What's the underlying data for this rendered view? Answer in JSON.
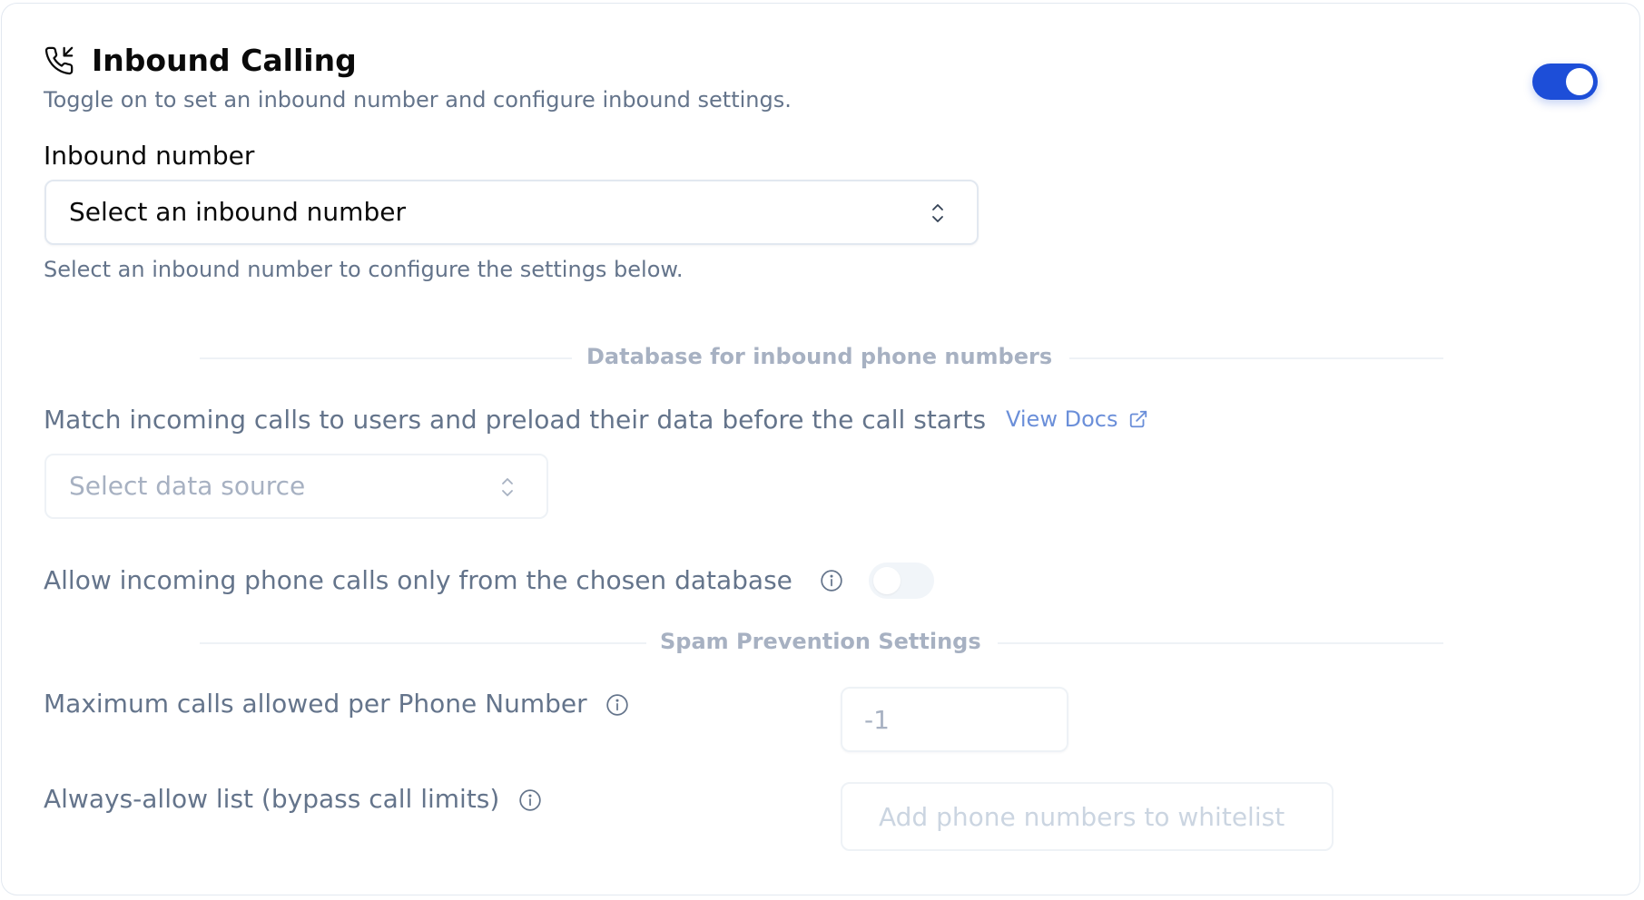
{
  "header": {
    "title": "Inbound Calling",
    "subtitle": "Toggle on to set an inbound number and configure inbound settings.",
    "icon": "phone-incoming-icon",
    "toggle_enabled": true,
    "accent_color": "#1d4ed8"
  },
  "inbound_number": {
    "label": "Inbound number",
    "placeholder": "Select an inbound number",
    "helper": "Select an inbound number to configure the settings below."
  },
  "database_section": {
    "heading": "Database for inbound phone numbers",
    "description": "Match incoming calls to users and preload their data before the call starts",
    "docs_link": "View Docs",
    "data_source_placeholder": "Select data source",
    "allow_only_label": "Allow incoming phone calls only from the chosen database",
    "allow_only_enabled": false
  },
  "spam_section": {
    "heading": "Spam Prevention Settings",
    "max_calls_label": "Maximum calls allowed per Phone Number",
    "max_calls_value": "-1",
    "whitelist_label": "Always-allow list (bypass call limits)",
    "whitelist_placeholder": "Add phone numbers to whitelist"
  }
}
